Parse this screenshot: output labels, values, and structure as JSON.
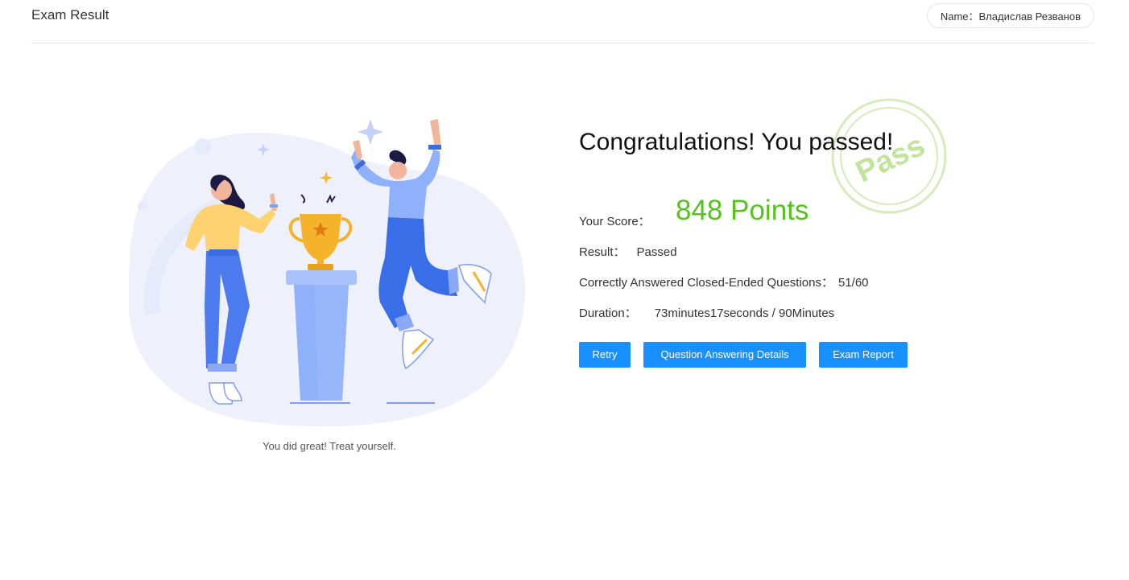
{
  "header": {
    "title": "Exam Result",
    "name_label": "Name：",
    "name_value": "Владислав Резванов"
  },
  "illustration": {
    "caption": "You did great! Treat yourself."
  },
  "result": {
    "headline": "Congratulations! You passed!",
    "stamp_text": "Pass",
    "score_label": "Your Score：",
    "score_value": "848 Points",
    "result_label": "Result：",
    "result_value": "Passed",
    "correct_label": "Correctly Answered Closed-Ended Questions：",
    "correct_value": "51/60",
    "duration_label": "Duration：",
    "duration_value": "73minutes17seconds / 90Minutes"
  },
  "buttons": {
    "retry": "Retry",
    "details": "Question Answering Details",
    "report": "Exam Report"
  },
  "colors": {
    "accent": "#1890ff",
    "score": "#52c41a",
    "stamp": "#b7e08a"
  }
}
